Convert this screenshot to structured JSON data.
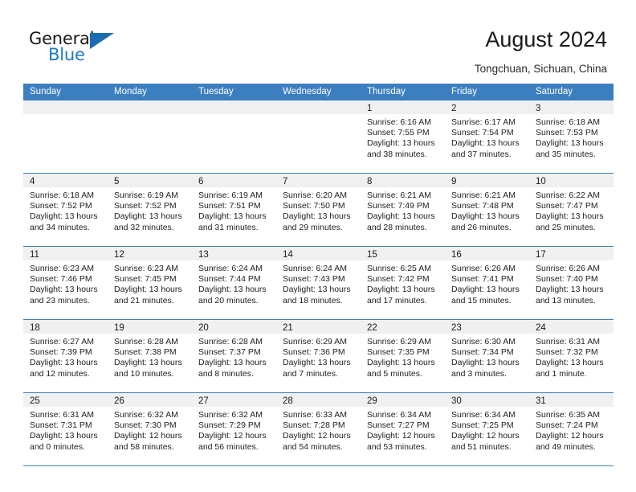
{
  "brand": {
    "name_part1": "General",
    "name_part2": "Blue",
    "flag_icon": "brand-flag-icon"
  },
  "header": {
    "title": "August 2024",
    "location": "Tongchuan, Sichuan, China"
  },
  "colors": {
    "header_blue": "#3c7fc1",
    "brand_blue": "#1b7bc4",
    "daynum_band": "#f0f0f0"
  },
  "calendar": {
    "weekday_headers": [
      "Sunday",
      "Monday",
      "Tuesday",
      "Wednesday",
      "Thursday",
      "Friday",
      "Saturday"
    ],
    "weeks": [
      [
        {
          "day": "",
          "empty": true,
          "sunrise": "",
          "sunset": "",
          "daylight_line1": "",
          "daylight_line2": ""
        },
        {
          "day": "",
          "empty": true,
          "sunrise": "",
          "sunset": "",
          "daylight_line1": "",
          "daylight_line2": ""
        },
        {
          "day": "",
          "empty": true,
          "sunrise": "",
          "sunset": "",
          "daylight_line1": "",
          "daylight_line2": ""
        },
        {
          "day": "",
          "empty": true,
          "sunrise": "",
          "sunset": "",
          "daylight_line1": "",
          "daylight_line2": ""
        },
        {
          "day": "1",
          "empty": false,
          "sunrise": "Sunrise: 6:16 AM",
          "sunset": "Sunset: 7:55 PM",
          "daylight_line1": "Daylight: 13 hours",
          "daylight_line2": "and 38 minutes."
        },
        {
          "day": "2",
          "empty": false,
          "sunrise": "Sunrise: 6:17 AM",
          "sunset": "Sunset: 7:54 PM",
          "daylight_line1": "Daylight: 13 hours",
          "daylight_line2": "and 37 minutes."
        },
        {
          "day": "3",
          "empty": false,
          "sunrise": "Sunrise: 6:18 AM",
          "sunset": "Sunset: 7:53 PM",
          "daylight_line1": "Daylight: 13 hours",
          "daylight_line2": "and 35 minutes."
        }
      ],
      [
        {
          "day": "4",
          "empty": false,
          "sunrise": "Sunrise: 6:18 AM",
          "sunset": "Sunset: 7:52 PM",
          "daylight_line1": "Daylight: 13 hours",
          "daylight_line2": "and 34 minutes."
        },
        {
          "day": "5",
          "empty": false,
          "sunrise": "Sunrise: 6:19 AM",
          "sunset": "Sunset: 7:52 PM",
          "daylight_line1": "Daylight: 13 hours",
          "daylight_line2": "and 32 minutes."
        },
        {
          "day": "6",
          "empty": false,
          "sunrise": "Sunrise: 6:19 AM",
          "sunset": "Sunset: 7:51 PM",
          "daylight_line1": "Daylight: 13 hours",
          "daylight_line2": "and 31 minutes."
        },
        {
          "day": "7",
          "empty": false,
          "sunrise": "Sunrise: 6:20 AM",
          "sunset": "Sunset: 7:50 PM",
          "daylight_line1": "Daylight: 13 hours",
          "daylight_line2": "and 29 minutes."
        },
        {
          "day": "8",
          "empty": false,
          "sunrise": "Sunrise: 6:21 AM",
          "sunset": "Sunset: 7:49 PM",
          "daylight_line1": "Daylight: 13 hours",
          "daylight_line2": "and 28 minutes."
        },
        {
          "day": "9",
          "empty": false,
          "sunrise": "Sunrise: 6:21 AM",
          "sunset": "Sunset: 7:48 PM",
          "daylight_line1": "Daylight: 13 hours",
          "daylight_line2": "and 26 minutes."
        },
        {
          "day": "10",
          "empty": false,
          "sunrise": "Sunrise: 6:22 AM",
          "sunset": "Sunset: 7:47 PM",
          "daylight_line1": "Daylight: 13 hours",
          "daylight_line2": "and 25 minutes."
        }
      ],
      [
        {
          "day": "11",
          "empty": false,
          "sunrise": "Sunrise: 6:23 AM",
          "sunset": "Sunset: 7:46 PM",
          "daylight_line1": "Daylight: 13 hours",
          "daylight_line2": "and 23 minutes."
        },
        {
          "day": "12",
          "empty": false,
          "sunrise": "Sunrise: 6:23 AM",
          "sunset": "Sunset: 7:45 PM",
          "daylight_line1": "Daylight: 13 hours",
          "daylight_line2": "and 21 minutes."
        },
        {
          "day": "13",
          "empty": false,
          "sunrise": "Sunrise: 6:24 AM",
          "sunset": "Sunset: 7:44 PM",
          "daylight_line1": "Daylight: 13 hours",
          "daylight_line2": "and 20 minutes."
        },
        {
          "day": "14",
          "empty": false,
          "sunrise": "Sunrise: 6:24 AM",
          "sunset": "Sunset: 7:43 PM",
          "daylight_line1": "Daylight: 13 hours",
          "daylight_line2": "and 18 minutes."
        },
        {
          "day": "15",
          "empty": false,
          "sunrise": "Sunrise: 6:25 AM",
          "sunset": "Sunset: 7:42 PM",
          "daylight_line1": "Daylight: 13 hours",
          "daylight_line2": "and 17 minutes."
        },
        {
          "day": "16",
          "empty": false,
          "sunrise": "Sunrise: 6:26 AM",
          "sunset": "Sunset: 7:41 PM",
          "daylight_line1": "Daylight: 13 hours",
          "daylight_line2": "and 15 minutes."
        },
        {
          "day": "17",
          "empty": false,
          "sunrise": "Sunrise: 6:26 AM",
          "sunset": "Sunset: 7:40 PM",
          "daylight_line1": "Daylight: 13 hours",
          "daylight_line2": "and 13 minutes."
        }
      ],
      [
        {
          "day": "18",
          "empty": false,
          "sunrise": "Sunrise: 6:27 AM",
          "sunset": "Sunset: 7:39 PM",
          "daylight_line1": "Daylight: 13 hours",
          "daylight_line2": "and 12 minutes."
        },
        {
          "day": "19",
          "empty": false,
          "sunrise": "Sunrise: 6:28 AM",
          "sunset": "Sunset: 7:38 PM",
          "daylight_line1": "Daylight: 13 hours",
          "daylight_line2": "and 10 minutes."
        },
        {
          "day": "20",
          "empty": false,
          "sunrise": "Sunrise: 6:28 AM",
          "sunset": "Sunset: 7:37 PM",
          "daylight_line1": "Daylight: 13 hours",
          "daylight_line2": "and 8 minutes."
        },
        {
          "day": "21",
          "empty": false,
          "sunrise": "Sunrise: 6:29 AM",
          "sunset": "Sunset: 7:36 PM",
          "daylight_line1": "Daylight: 13 hours",
          "daylight_line2": "and 7 minutes."
        },
        {
          "day": "22",
          "empty": false,
          "sunrise": "Sunrise: 6:29 AM",
          "sunset": "Sunset: 7:35 PM",
          "daylight_line1": "Daylight: 13 hours",
          "daylight_line2": "and 5 minutes."
        },
        {
          "day": "23",
          "empty": false,
          "sunrise": "Sunrise: 6:30 AM",
          "sunset": "Sunset: 7:34 PM",
          "daylight_line1": "Daylight: 13 hours",
          "daylight_line2": "and 3 minutes."
        },
        {
          "day": "24",
          "empty": false,
          "sunrise": "Sunrise: 6:31 AM",
          "sunset": "Sunset: 7:32 PM",
          "daylight_line1": "Daylight: 13 hours",
          "daylight_line2": "and 1 minute."
        }
      ],
      [
        {
          "day": "25",
          "empty": false,
          "sunrise": "Sunrise: 6:31 AM",
          "sunset": "Sunset: 7:31 PM",
          "daylight_line1": "Daylight: 13 hours",
          "daylight_line2": "and 0 minutes."
        },
        {
          "day": "26",
          "empty": false,
          "sunrise": "Sunrise: 6:32 AM",
          "sunset": "Sunset: 7:30 PM",
          "daylight_line1": "Daylight: 12 hours",
          "daylight_line2": "and 58 minutes."
        },
        {
          "day": "27",
          "empty": false,
          "sunrise": "Sunrise: 6:32 AM",
          "sunset": "Sunset: 7:29 PM",
          "daylight_line1": "Daylight: 12 hours",
          "daylight_line2": "and 56 minutes."
        },
        {
          "day": "28",
          "empty": false,
          "sunrise": "Sunrise: 6:33 AM",
          "sunset": "Sunset: 7:28 PM",
          "daylight_line1": "Daylight: 12 hours",
          "daylight_line2": "and 54 minutes."
        },
        {
          "day": "29",
          "empty": false,
          "sunrise": "Sunrise: 6:34 AM",
          "sunset": "Sunset: 7:27 PM",
          "daylight_line1": "Daylight: 12 hours",
          "daylight_line2": "and 53 minutes."
        },
        {
          "day": "30",
          "empty": false,
          "sunrise": "Sunrise: 6:34 AM",
          "sunset": "Sunset: 7:25 PM",
          "daylight_line1": "Daylight: 12 hours",
          "daylight_line2": "and 51 minutes."
        },
        {
          "day": "31",
          "empty": false,
          "sunrise": "Sunrise: 6:35 AM",
          "sunset": "Sunset: 7:24 PM",
          "daylight_line1": "Daylight: 12 hours",
          "daylight_line2": "and 49 minutes."
        }
      ]
    ]
  }
}
